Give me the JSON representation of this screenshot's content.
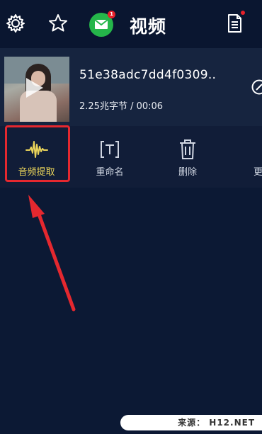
{
  "header": {
    "title": "视频",
    "icons": [
      "settings-icon",
      "star-icon",
      "mail-icon",
      "document-icon"
    ],
    "mail_badge": "1"
  },
  "video": {
    "name": "51e38adc7dd4f0309..",
    "meta": "2.25兆字节 / 00:06"
  },
  "actions": [
    {
      "label": "音频提取",
      "icon": "audio-wave-icon"
    },
    {
      "label": "重命名",
      "icon": "rename-icon"
    },
    {
      "label": "删除",
      "icon": "trash-icon"
    },
    {
      "label": "更",
      "icon": "more-icon"
    }
  ],
  "watermark": "来源： H12.NET",
  "colors": {
    "background": "#0c1934",
    "card": "#16243f",
    "accent_gold": "#e9d35a",
    "annotation_red": "#e5282f",
    "mail_green": "#25b64a"
  }
}
